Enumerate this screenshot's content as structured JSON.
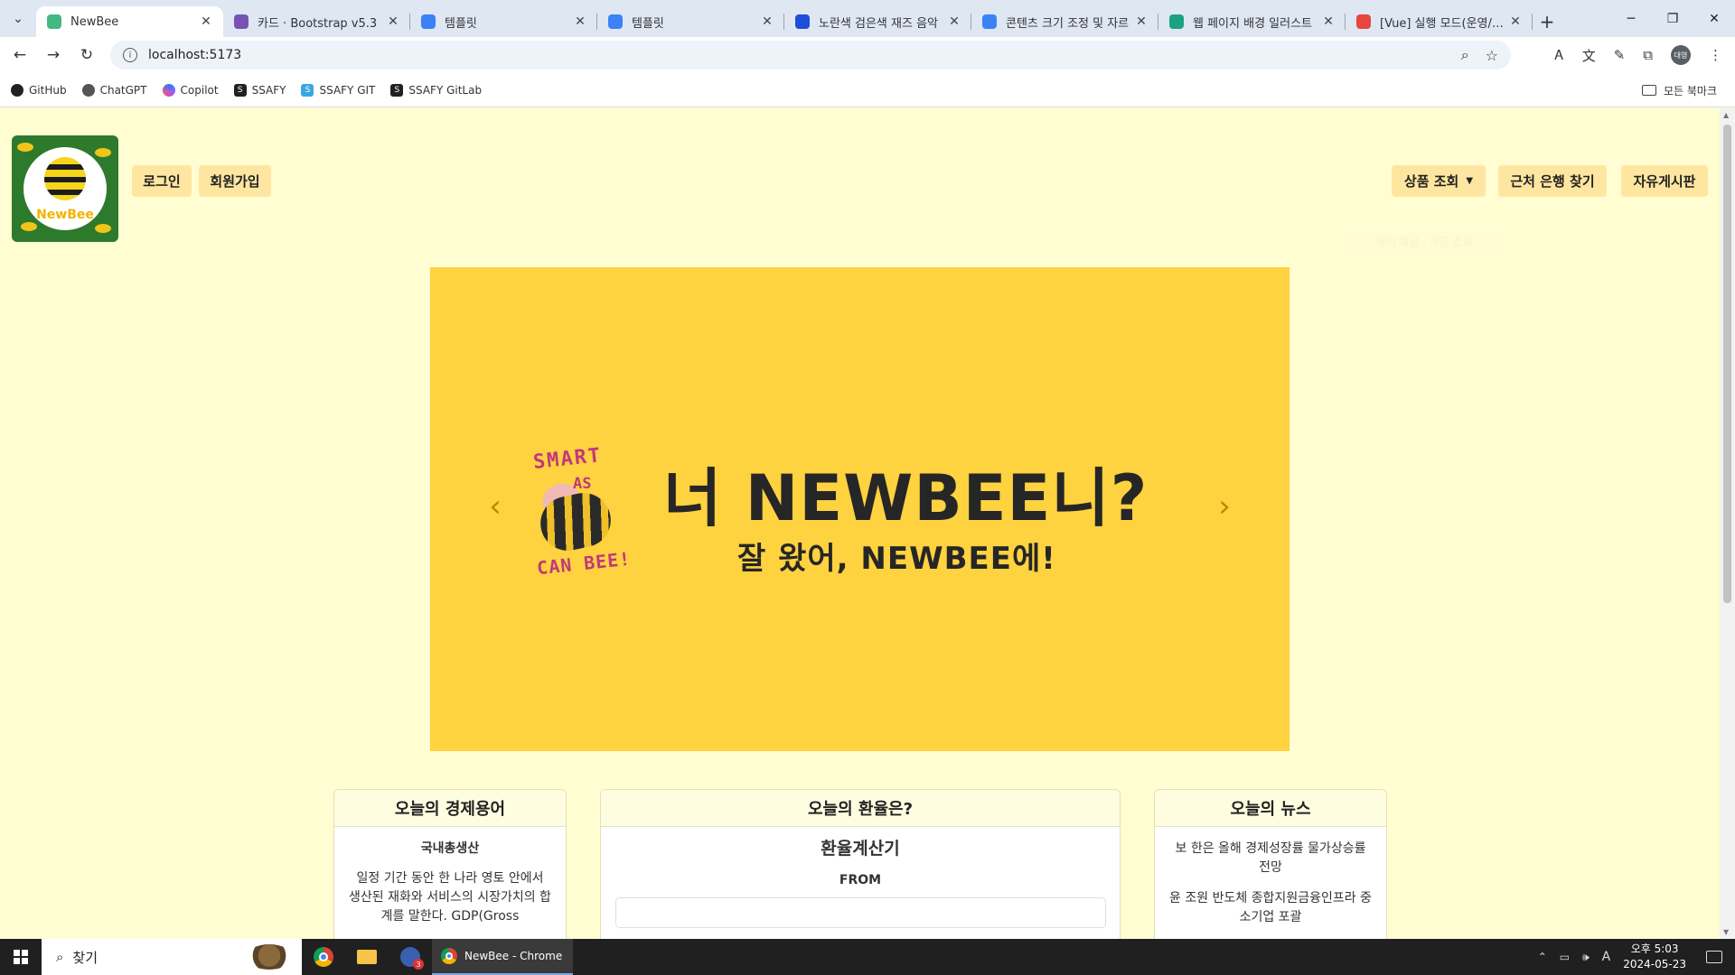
{
  "browser": {
    "tabs": [
      {
        "title": "NewBee",
        "favicon": "vue-icon",
        "color": "#42b883",
        "active": true
      },
      {
        "title": "카드 · Bootstrap v5.3",
        "favicon": "bootstrap-icon",
        "color": "#7952b3",
        "active": false
      },
      {
        "title": "템플릿",
        "favicon": "canva-icon",
        "color": "#3b82f6",
        "active": false
      },
      {
        "title": "템플릿",
        "favicon": "canva-icon",
        "color": "#3b82f6",
        "active": false
      },
      {
        "title": "노란색 검은색 재즈 음악",
        "favicon": "heart-chat-icon",
        "color": "#1e4fd8",
        "active": false
      },
      {
        "title": "콘텐츠 크기 조정 및 자르",
        "favicon": "canva-icon",
        "color": "#3b82f6",
        "active": false
      },
      {
        "title": "웹 페이지 배경 일러스트",
        "favicon": "chatgpt-icon",
        "color": "#19a37f",
        "active": false
      },
      {
        "title": "[Vue] 실행 모드(운영/개발",
        "favicon": "tistory-icon",
        "color": "#e8463c",
        "active": false
      }
    ],
    "url": "localhost:5173",
    "bookmarks": [
      "GitHub",
      "ChatGPT",
      "Copilot",
      "SSAFY",
      "SSAFY GIT",
      "SSAFY GitLab"
    ],
    "bookmarks_folder": "모든 북마크",
    "profile_label": "대영"
  },
  "site": {
    "logo_text": "NewBee",
    "login": "로그인",
    "signup": "회원가입",
    "nav_products": "상품 조회",
    "nav_bank": "근처 은행 찾기",
    "nav_board": "자유게시판",
    "ghost_text": "정기 예금 · 적금 조회",
    "carousel": {
      "smart1": "SMART",
      "smart2": "AS",
      "smart3": "CAN BEE!",
      "headline": "너 NEWBEE니?",
      "subline": "잘 왔어, NEWBEE에!",
      "prev": "‹",
      "next": "›",
      "background": "#ffd23f"
    },
    "cards": {
      "term": {
        "header": "오늘의 경제용어",
        "title": "국내총생산",
        "desc": "일정 기간 동안 한 나라 영토 안에서 생산된 재화와 서비스의 시장가치의 합계를 말한다. GDP(Gross"
      },
      "exchange": {
        "header": "오늘의 환율은?",
        "title": "환율계산기",
        "from_label": "FROM"
      },
      "news": {
        "header": "오늘의 뉴스",
        "items": [
          "보 한은 올해 경제성장률 물가상승률 전망",
          "윤 조원 반도체 종합지원금융인프라 중소기업 포괄"
        ]
      }
    }
  },
  "taskbar": {
    "search_placeholder": "찾기",
    "running_app": "NewBee - Chrome",
    "badge_count": "3",
    "time": "오후 5:03",
    "date": "2024-05-23",
    "ime": "A"
  }
}
